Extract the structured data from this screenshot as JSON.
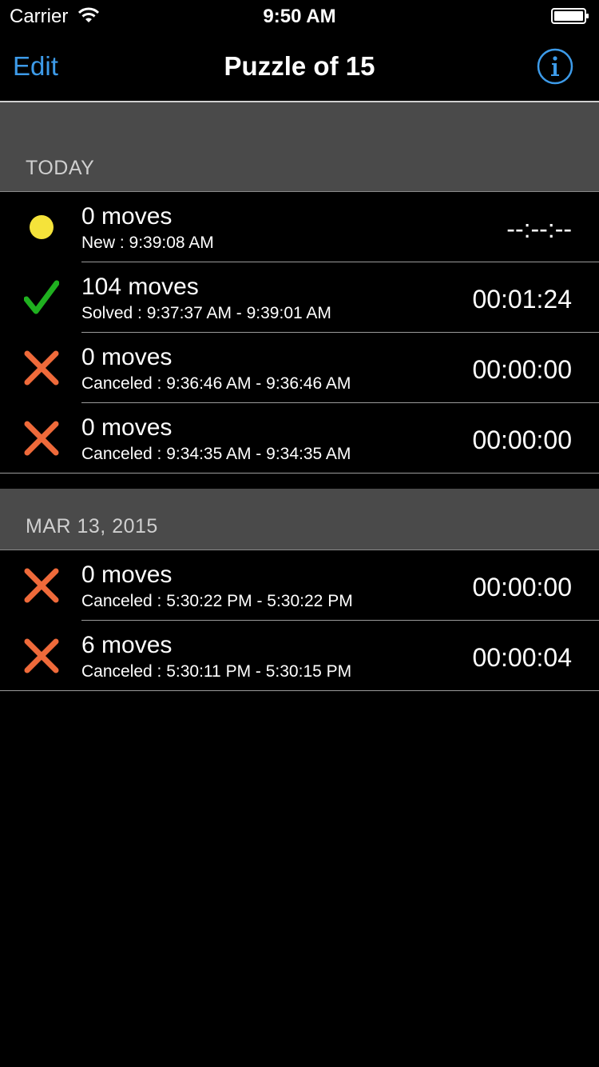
{
  "status_bar": {
    "carrier": "Carrier",
    "time": "9:50 AM",
    "wifi_icon": "wifi-icon",
    "battery_icon": "battery-icon"
  },
  "nav": {
    "edit_label": "Edit",
    "title": "Puzzle of 15",
    "info_icon": "info-icon",
    "accent_color": "#3d9be9"
  },
  "sections": [
    {
      "title": "TODAY",
      "rows": [
        {
          "status": "new",
          "icon": "yellow-dot-icon",
          "moves": "0 moves",
          "detail": "New : 9:39:08 AM",
          "time": "--:--:--"
        },
        {
          "status": "solved",
          "icon": "checkmark-icon",
          "moves": "104 moves",
          "detail": "Solved : 9:37:37 AM - 9:39:01 AM",
          "time": "00:01:24"
        },
        {
          "status": "canceled",
          "icon": "cross-icon",
          "moves": "0 moves",
          "detail": "Canceled : 9:36:46 AM - 9:36:46 AM",
          "time": "00:00:00"
        },
        {
          "status": "canceled",
          "icon": "cross-icon",
          "moves": "0 moves",
          "detail": "Canceled : 9:34:35 AM - 9:34:35 AM",
          "time": "00:00:00"
        }
      ]
    },
    {
      "title": "MAR 13, 2015",
      "rows": [
        {
          "status": "canceled",
          "icon": "cross-icon",
          "moves": "0 moves",
          "detail": "Canceled : 5:30:22 PM - 5:30:22 PM",
          "time": "00:00:00"
        },
        {
          "status": "canceled",
          "icon": "cross-icon",
          "moves": "6 moves",
          "detail": "Canceled : 5:30:11 PM - 5:30:15 PM",
          "time": "00:00:04"
        }
      ]
    }
  ],
  "colors": {
    "new": "#f5e33a",
    "solved": "#1fb01f",
    "canceled": "#ef6a3a",
    "section_bg": "#4a4a4a"
  }
}
